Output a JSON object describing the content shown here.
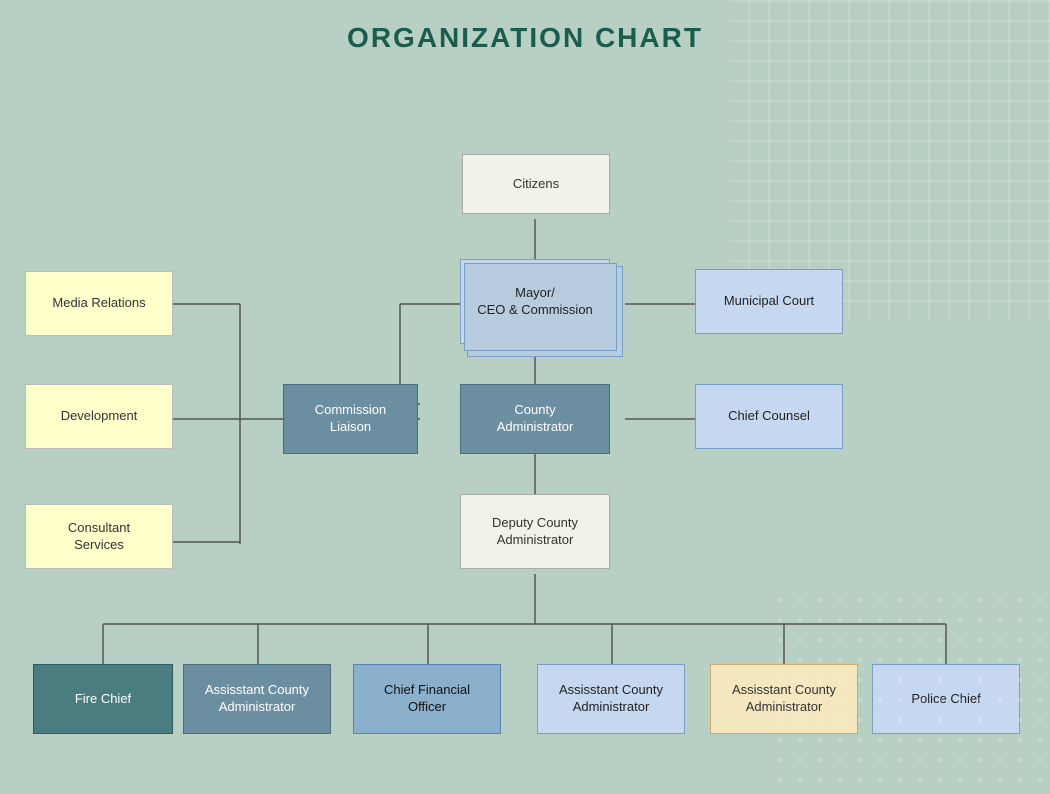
{
  "title": "ORGANIZATION CHART",
  "boxes": {
    "citizens": {
      "label": "Citizens"
    },
    "mayor": {
      "label": "Mayor/\nCEO & Commission"
    },
    "municipal_court": {
      "label": "Municipal Court"
    },
    "media_relations": {
      "label": "Media Relations"
    },
    "development": {
      "label": "Development"
    },
    "consultant_services": {
      "label": "Consultant\nServices"
    },
    "commission_liaison": {
      "label": "Commission\nLiaison"
    },
    "county_administrator": {
      "label": "County\nAdministrator"
    },
    "chief_counsel": {
      "label": "Chief Counsel"
    },
    "deputy_county_admin": {
      "label": "Deputy County\nAdministrator"
    },
    "fire_chief": {
      "label": "Fire Chief"
    },
    "asst_admin_1": {
      "label": "Assisstant County\nAdministrator"
    },
    "cfo": {
      "label": "Chief Financial\nOfficer"
    },
    "asst_admin_2": {
      "label": "Assisstant County\nAdministrator"
    },
    "asst_admin_3": {
      "label": "Assisstant County\nAdministrator"
    },
    "police_chief": {
      "label": "Police Chief"
    }
  }
}
